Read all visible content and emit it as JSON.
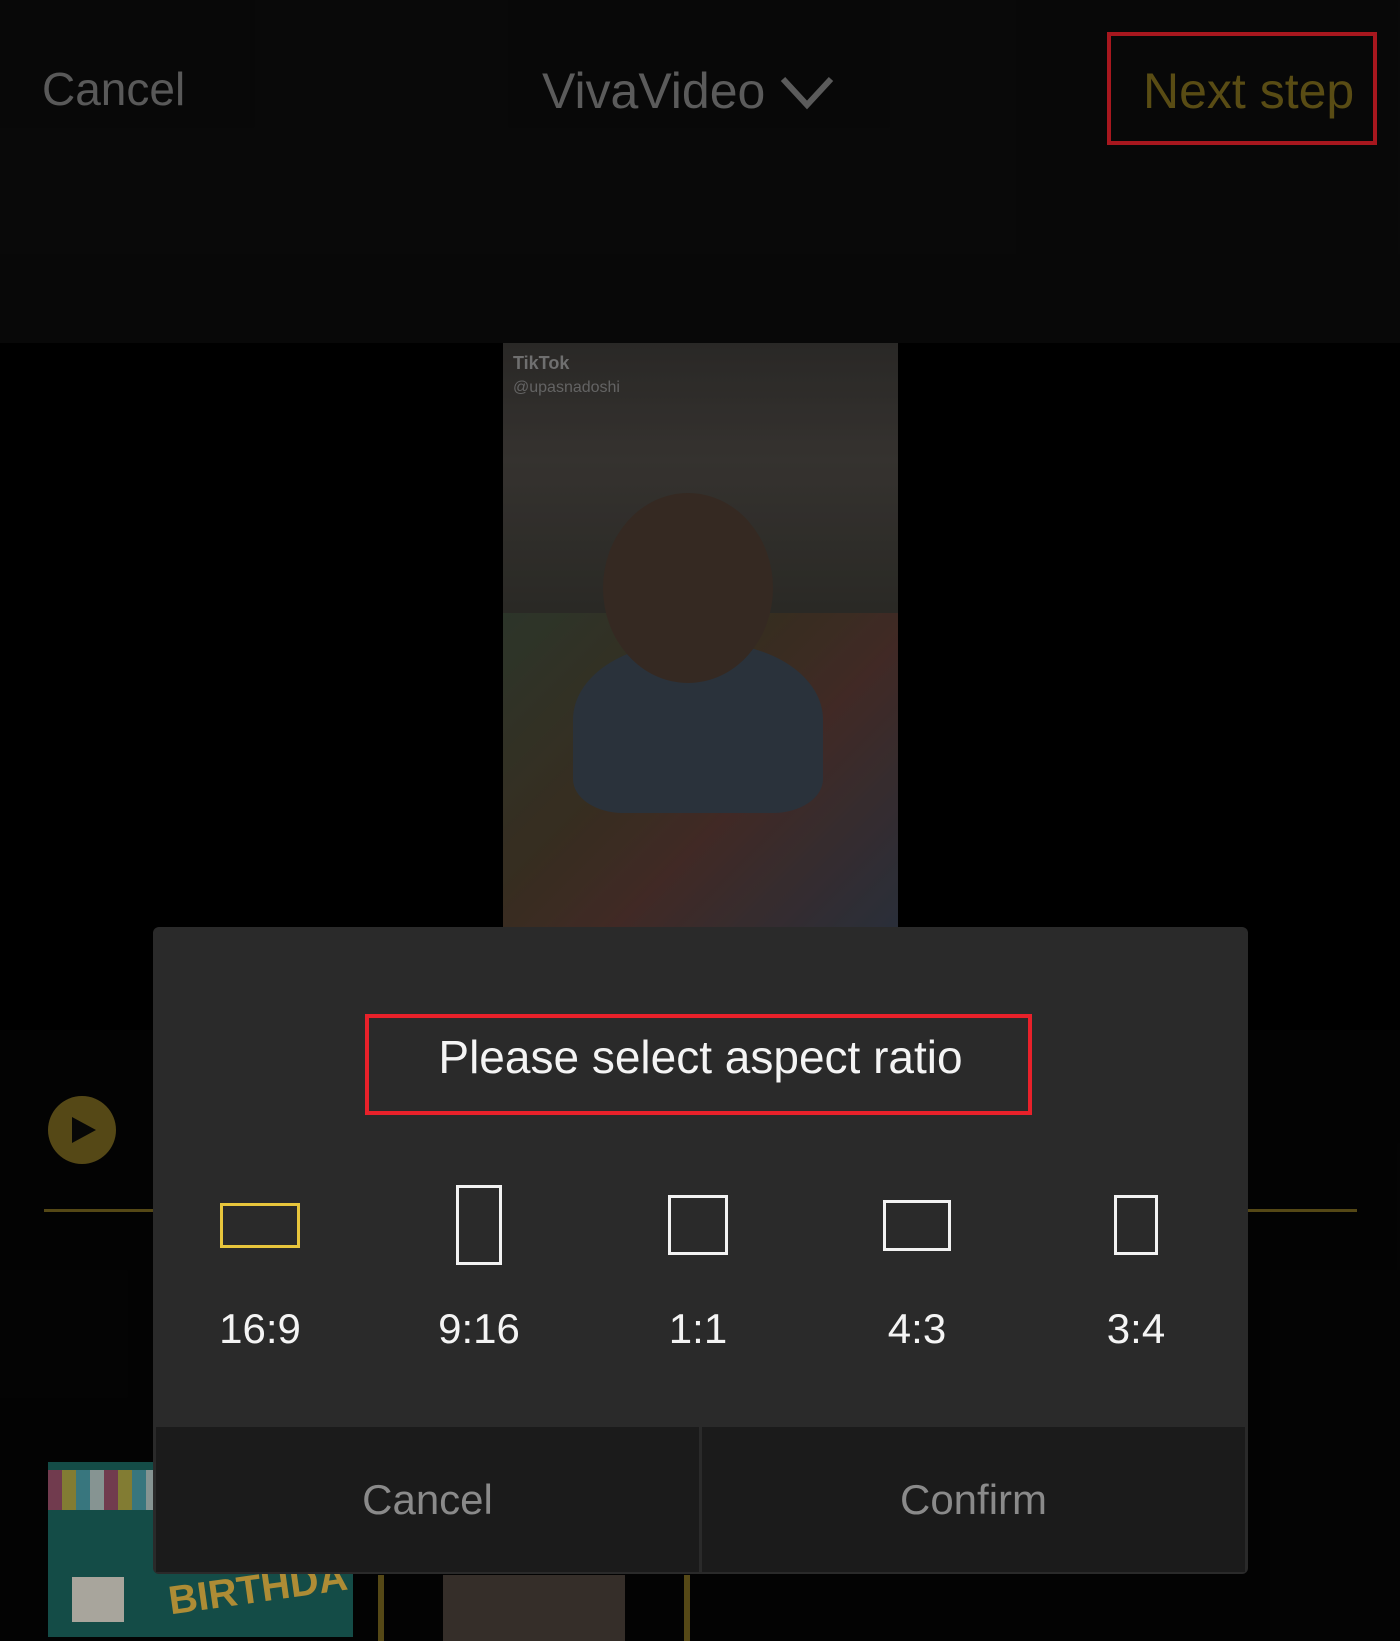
{
  "topbar": {
    "cancel_label": "Cancel",
    "app_title": "VivaVideo",
    "next_label": "Next step"
  },
  "video": {
    "watermark_logo": "TikTok",
    "watermark_user": "@upasnadoshi"
  },
  "thumbnail": {
    "text": "BIRTHDA"
  },
  "dialog": {
    "title": "Please select aspect ratio",
    "ratios": [
      {
        "label": "16:9",
        "selected": true
      },
      {
        "label": "9:16",
        "selected": false
      },
      {
        "label": "1:1",
        "selected": false
      },
      {
        "label": "4:3",
        "selected": false
      },
      {
        "label": "3:4",
        "selected": false
      }
    ],
    "cancel_label": "Cancel",
    "confirm_label": "Confirm"
  },
  "colors": {
    "accent_gold": "#77651f",
    "selected_yellow": "#e7c53c",
    "highlight_red": "#e8212a"
  },
  "icons": [
    "chevron-down-icon",
    "play-icon"
  ]
}
